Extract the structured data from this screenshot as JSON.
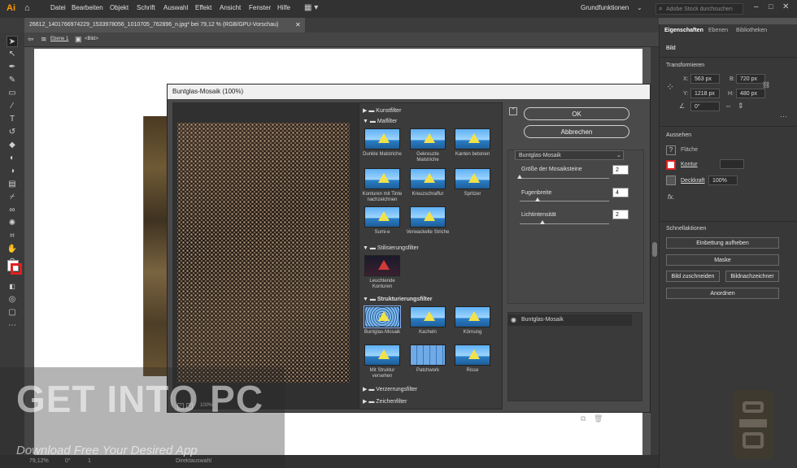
{
  "app": {
    "logo": "Ai"
  },
  "menu": [
    "Datei",
    "Bearbeiten",
    "Objekt",
    "Schrift",
    "Auswahl",
    "Effekt",
    "Ansicht",
    "Fenster",
    "Hilfe"
  ],
  "workspace": "Grundfunktionen",
  "search_placeholder": "Adobe Stock durchsuchen",
  "doc_tab": "26612_1401766974229_1533978056_1010705_762896_n.jpg* bei 79,12 % (RGB/GPU-Vorschau)",
  "breadcrumb": {
    "layer": "Ebene 1",
    "object": "<Bild>"
  },
  "status": {
    "zoom": "79,12%",
    "rotation": "0°",
    "page": "1",
    "tool": "Direktauswahl"
  },
  "dialog": {
    "title": "Buntglas-Mosaik (100%)",
    "zoom": "100%",
    "categories": [
      "Kunstfilter",
      "Malfilter",
      "Stilisierungsfilter",
      "Strukturierungsfilter",
      "Verzerrungsfilter",
      "Zeichenfilter"
    ],
    "malfilter": [
      "Dunkle Malstriche",
      "Gekreuzte Malstriche",
      "Kanten betonen",
      "Konturen mit Tinte nachzeichnen",
      "Kreuzschraffur",
      "Spritzer",
      "Sumi-e",
      "Verwackelte Striche"
    ],
    "stilisierung": [
      "Leuchtende Konturen"
    ],
    "struktur": [
      "Buntglas-Mosaik",
      "Kacheln",
      "Körnung",
      "Mit Struktur versehen",
      "Patchwork",
      "Risse"
    ],
    "ok_label": "OK",
    "cancel_label": "Abbrechen",
    "selected_filter": "Buntglas-Mosaik",
    "params": [
      {
        "label": "Größe der Mosaiksteine",
        "value": "2",
        "level": 0.0
      },
      {
        "label": "Fugenbreite",
        "value": "4",
        "level": 0.2
      },
      {
        "label": "Lichtintensität",
        "value": "2",
        "level": 0.25
      }
    ],
    "layer_item": "Buntglas-Mosaik"
  },
  "panel": {
    "tabs": [
      "Eigenschaften",
      "Ebenen",
      "Bibliotheken"
    ],
    "object": "Bild",
    "transform_title": "Transformieren",
    "x": "563 px",
    "y": "1218 px",
    "b": "720 px",
    "h": "480 px",
    "angle": "0°",
    "x_label": "X:",
    "y_label": "Y:",
    "b_label": "B:",
    "h_label": "H:",
    "appearance_title": "Aussehen",
    "fill_label": "Fläche",
    "stroke_label": "Kontur",
    "opacity_label": "Deckkraft",
    "opacity": "100%",
    "fx": "fx.",
    "quick_title": "Schnellaktionen",
    "quick_actions": [
      "Einbettung aufheben",
      "Maske"
    ],
    "crop": "Bild zuschneiden",
    "trace": "Bildnachzeichner",
    "arrange": "Anordnen"
  },
  "watermark": {
    "title": "GET INTO PC",
    "subtitle": "Download Free Your Desired App"
  }
}
